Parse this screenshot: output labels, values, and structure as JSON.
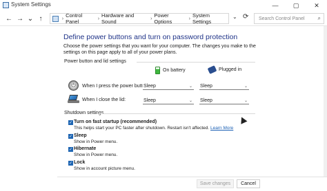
{
  "window": {
    "title": "System Settings",
    "controls": {
      "minimize": "—",
      "maximize": "▢",
      "close": "✕"
    }
  },
  "nav": {
    "back": "←",
    "forward": "→",
    "recent": "⌄",
    "up": "↑",
    "dropdown": "⌄",
    "refresh": "⟳"
  },
  "breadcrumb": [
    "Control Panel",
    "Hardware and Sound",
    "Power Options",
    "System Settings"
  ],
  "breadcrumb_sep": "›",
  "search": {
    "placeholder": "Search Control Panel"
  },
  "page": {
    "title": "Define power buttons and turn on password protection",
    "description": "Choose the power settings that you want for your computer. The changes you make to the settings on this page apply to all of your power plans."
  },
  "power_section": {
    "label": "Power button and lid settings",
    "col_battery": "On battery",
    "col_plugged": "Plugged in",
    "rows": [
      {
        "label": "When I press the power button:",
        "battery": "Sleep",
        "plugged": "Sleep"
      },
      {
        "label": "When I close the lid:",
        "battery": "Sleep",
        "plugged": "Sleep"
      }
    ]
  },
  "shutdown_section": {
    "label": "Shutdown settings",
    "options": [
      {
        "label": "Turn on fast startup (recommended)",
        "desc": "This helps start your PC faster after shutdown. Restart isn't affected.",
        "link": "Learn More",
        "checked": true
      },
      {
        "label": "Sleep",
        "desc": "Show in Power menu.",
        "checked": true
      },
      {
        "label": "Hibernate",
        "desc": "Show in Power menu.",
        "checked": true
      },
      {
        "label": "Lock",
        "desc": "Show in account picture menu.",
        "checked": true
      }
    ]
  },
  "buttons": {
    "save": "Save changes",
    "cancel": "Cancel"
  },
  "colors": {
    "accent": "#1f66b3",
    "heading": "#1e3287",
    "link": "#1a5fb4"
  }
}
